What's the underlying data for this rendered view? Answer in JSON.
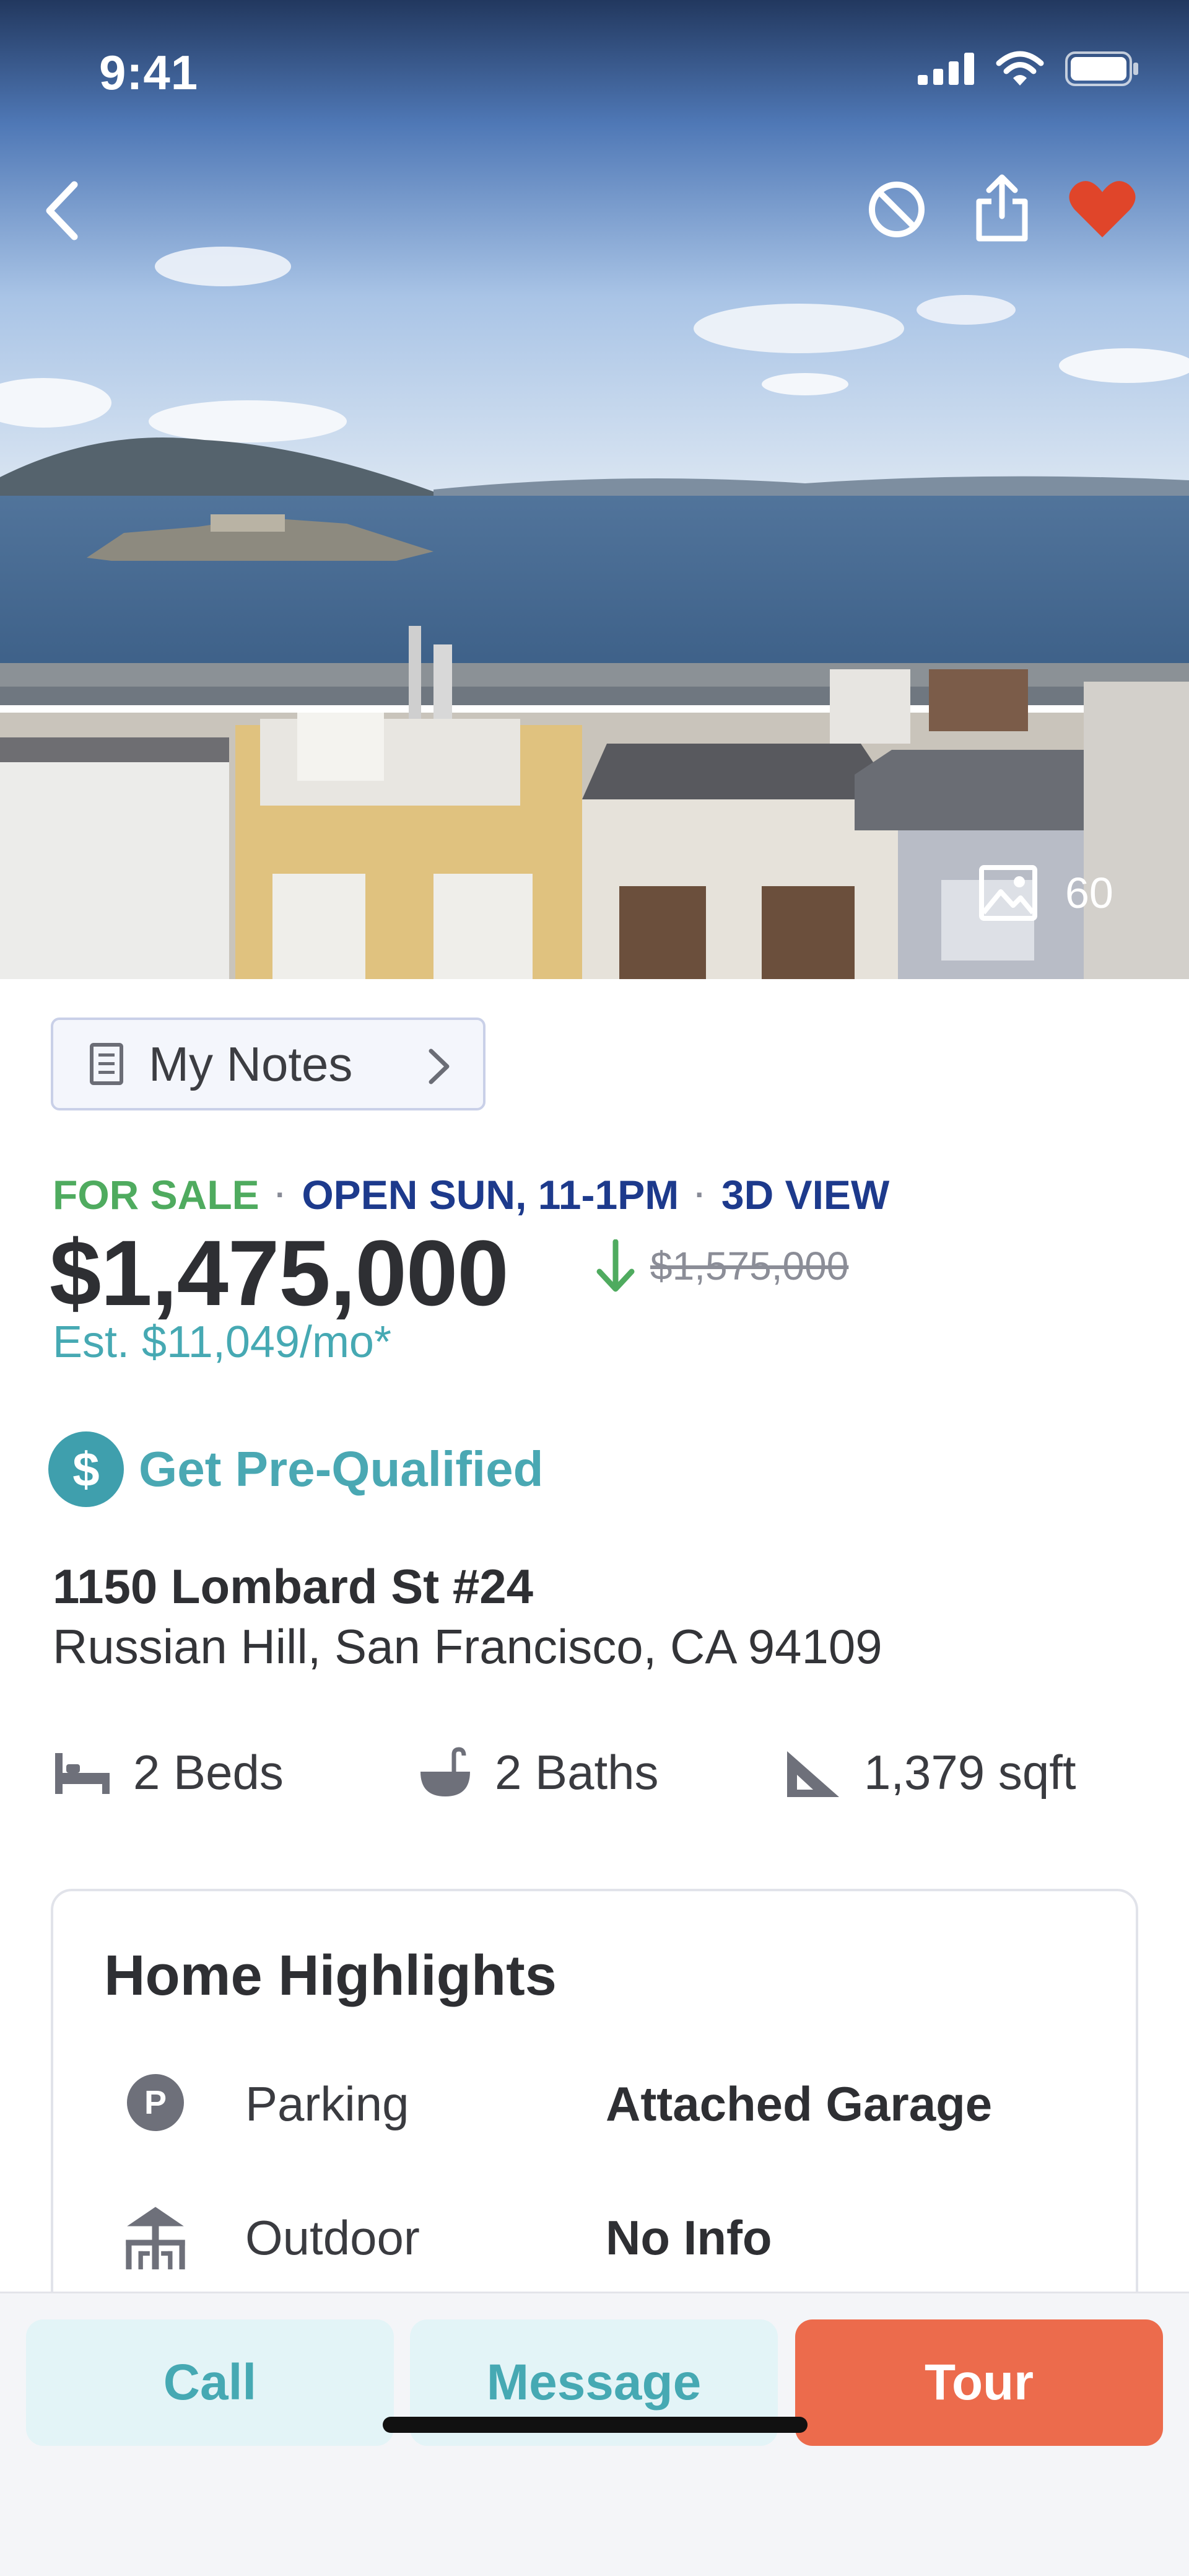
{
  "status_bar": {
    "time": "9:41"
  },
  "hero": {
    "photo_count": "60",
    "icons": [
      "back-chevron-icon",
      "block-icon",
      "share-icon",
      "heart-icon",
      "photos-icon"
    ]
  },
  "notes": {
    "label": "My Notes"
  },
  "listing": {
    "status": "FOR SALE",
    "separator": "·",
    "open_house": "OPEN SUN, 11-1PM",
    "view_3d": "3D VIEW",
    "price": "$1,475,000",
    "old_price": "$1,575,000",
    "estimate": "Est. $11,049/mo*",
    "prequal_label": "Get Pre-Qualified",
    "prequal_symbol": "$",
    "address_line1": "1150 Lombard St #24",
    "address_line2": "Russian Hill, San Francisco, CA 94109"
  },
  "facts": {
    "beds": "2 Beds",
    "baths": "2 Baths",
    "sqft": "1,379 sqft"
  },
  "highlights": {
    "title": "Home Highlights",
    "rows": [
      {
        "name": "Parking",
        "value": "Attached Garage",
        "icon": "parking-icon"
      },
      {
        "name": "Outdoor",
        "value": "No Info",
        "icon": "outdoor-icon"
      }
    ]
  },
  "actions": {
    "call": "Call",
    "message": "Message",
    "tour": "Tour"
  },
  "colors": {
    "accent_teal": "#46a9b3",
    "tour_orange": "#ec6b4c",
    "for_sale_green": "#4fab5f",
    "open_house_blue": "#1d3a8c",
    "favorite_red": "#e0452a"
  }
}
